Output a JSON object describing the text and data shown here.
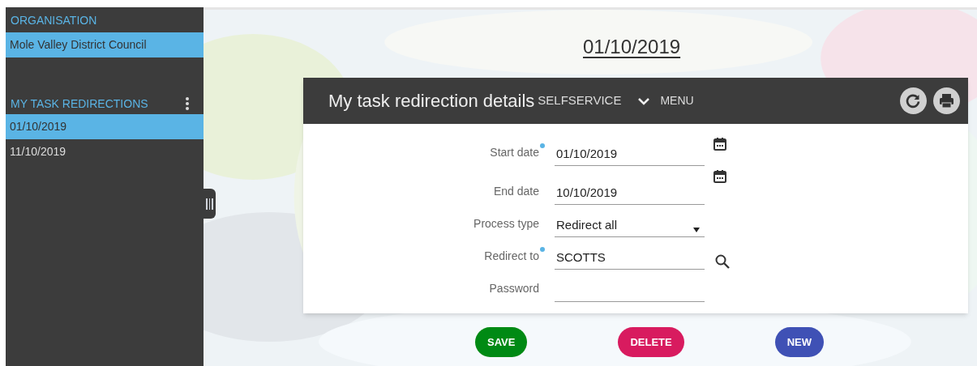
{
  "sidebar": {
    "organisation_heading": "ORGANISATION",
    "organisations": [
      {
        "label": "Mole Valley District Council",
        "selected": true
      }
    ],
    "redirections_heading": "MY TASK REDIRECTIONS",
    "redirections": [
      {
        "label": "01/10/2019",
        "selected": true
      },
      {
        "label": "11/10/2019",
        "selected": false
      }
    ]
  },
  "page_title": "01/10/2019",
  "card": {
    "title": "My task redirection details",
    "module": "SELFSERVICE",
    "menu": "MENU",
    "fields": [
      {
        "kind": "date",
        "label": "Start date",
        "required": true,
        "value": "01/10/2019"
      },
      {
        "kind": "date",
        "label": "End date",
        "required": false,
        "value": "10/10/2019"
      },
      {
        "kind": "select",
        "label": "Process type",
        "required": false,
        "value": "Redirect all"
      },
      {
        "kind": "lookup",
        "label": "Redirect to",
        "required": true,
        "value": "SCOTTS"
      },
      {
        "kind": "text",
        "label": "Password",
        "required": false
      }
    ]
  },
  "buttons": [
    {
      "kind": "save",
      "label": "SAVE"
    },
    {
      "kind": "delete",
      "label": "DELETE"
    },
    {
      "kind": "new",
      "label": "NEW"
    }
  ]
}
